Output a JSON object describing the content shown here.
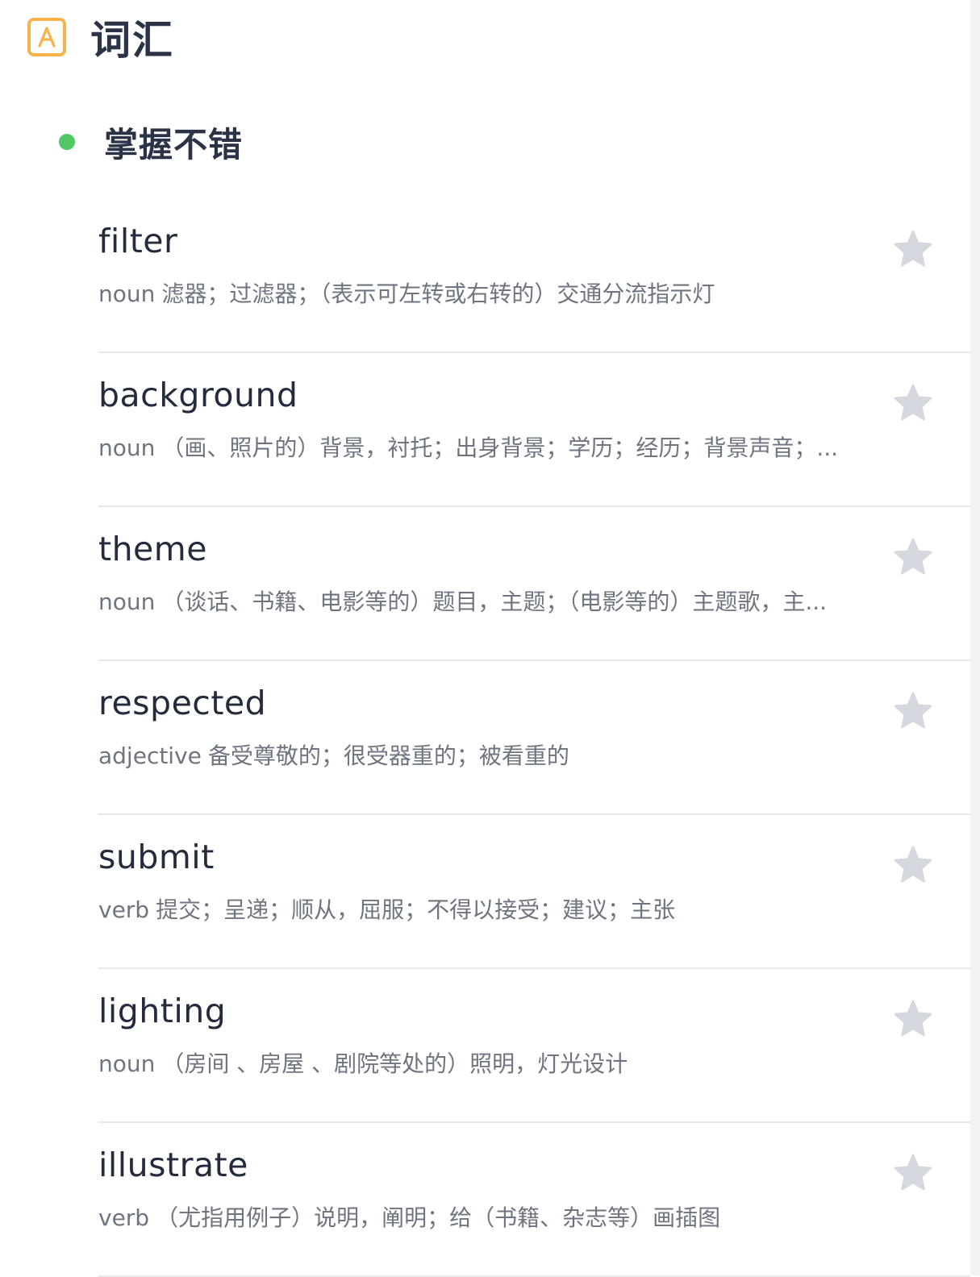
{
  "header": {
    "icon": "vocab-a-icon",
    "icon_letter": "A",
    "title": "词汇"
  },
  "section": {
    "title": "掌握不错",
    "status_color": "#52c766"
  },
  "words": [
    {
      "word": "filter",
      "pos": "noun",
      "meaning": "滤器；过滤器；（表示可左转或右转的）交通分流指示灯"
    },
    {
      "word": "background",
      "pos": "noun",
      "meaning": "（画、照片的）背景，衬托；出身背景；学历；经历；背景声音；..."
    },
    {
      "word": "theme",
      "pos": "noun",
      "meaning": "（谈话、书籍、电影等的）题目，主题；（电影等的）主题歌，主..."
    },
    {
      "word": "respected",
      "pos": "adjective",
      "meaning": "备受尊敬的；很受器重的；被看重的"
    },
    {
      "word": "submit",
      "pos": "verb",
      "meaning": "提交；呈递；顺从，屈服；不得以接受；建议；主张"
    },
    {
      "word": "lighting",
      "pos": "noun",
      "meaning": "（房间 、房屋 、剧院等处的）照明，灯光设计"
    },
    {
      "word": "illustrate",
      "pos": "verb",
      "meaning": "（尤指用例子）说明，阐明；给（书籍、杂志等）画插图"
    }
  ],
  "icons": {
    "star": "star-icon"
  },
  "colors": {
    "accent_orange": "#f7b34a",
    "star_gray": "#d5d9df",
    "text_primary": "#232b3d",
    "text_secondary": "#6e7480"
  }
}
